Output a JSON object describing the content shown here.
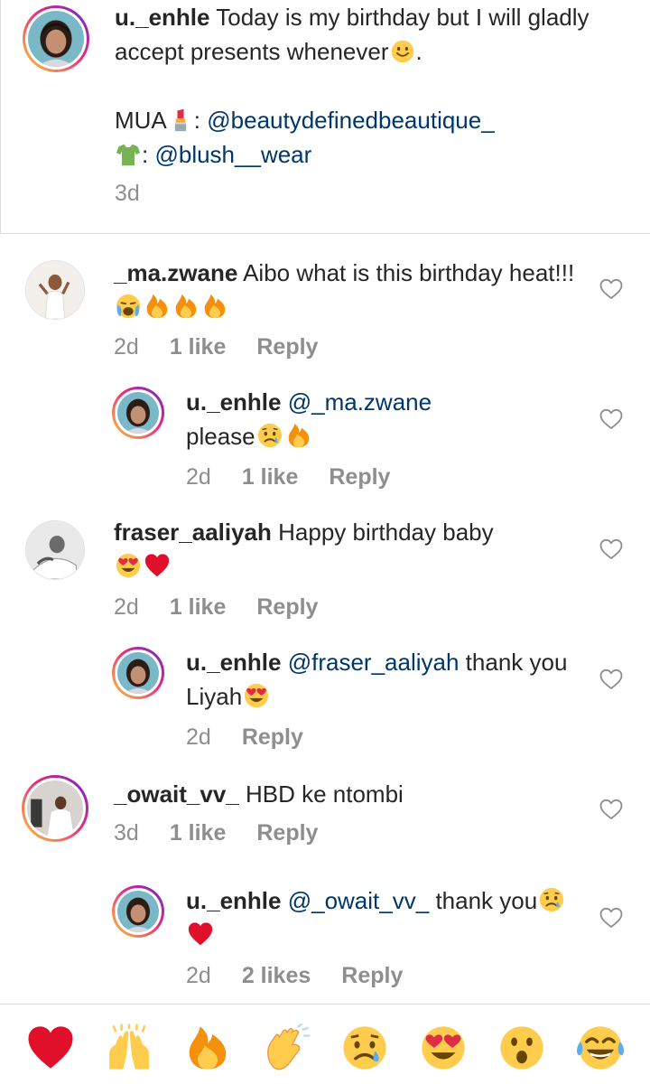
{
  "caption": {
    "username": "u._enhle",
    "text": "Today is my birthday but I will gladly accept presents whenever",
    "after_smiley": ".",
    "mua_label": "MUA",
    "mua_colon": ":",
    "mua_handle": "@beautydefinedbeautique_",
    "shirt_colon": ":",
    "shirt_handle": "@blush__wear",
    "time": "3d"
  },
  "comments": [
    {
      "username": "_ma.zwane",
      "text_pre": "Aibo what is this birthday heat!!!",
      "time": "2d",
      "likes": "1 like",
      "reply": "Reply"
    },
    {
      "username": "u._enhle",
      "mention": "@_ma.zwane",
      "text_pre": "please",
      "time": "2d",
      "likes": "1 like",
      "reply": "Reply"
    },
    {
      "username": "fraser_aaliyah",
      "text_pre": "Happy birthday baby",
      "time": "2d",
      "likes": "1 like",
      "reply": "Reply"
    },
    {
      "username": "u._enhle",
      "mention": "@fraser_aaliyah",
      "text_pre": "thank you Liyah",
      "time": "2d",
      "reply": "Reply"
    },
    {
      "username": "_owait_vv_",
      "text_pre": "HBD ke ntombi",
      "time": "3d",
      "likes": "1 like",
      "reply": "Reply"
    },
    {
      "username": "u._enhle",
      "mention": "@_owait_vv_",
      "text_pre": "thank you",
      "time": "2d",
      "likes": "2 likes",
      "reply": "Reply"
    }
  ],
  "reactions": [
    "heart",
    "raising-hands",
    "fire",
    "clapping-hands",
    "sad-sweat-face",
    "heart-eyes-face",
    "surprised-face",
    "tears-of-joy-face"
  ],
  "colors": {
    "mention": "#00376b",
    "meta": "#8e8e8e",
    "text": "#262626",
    "divider": "#dbdbdb"
  }
}
